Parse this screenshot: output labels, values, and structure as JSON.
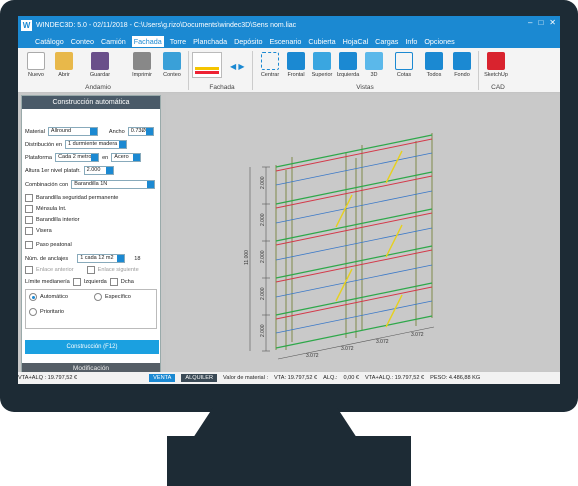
{
  "window": {
    "title": "WINDEC3D: 5.0 - 02/11/2018 - C:\\Users\\g.rizo\\Documents\\windec3D\\Sens nom.liac"
  },
  "menu": [
    "Catálogo",
    "Conteo",
    "Camión",
    "Fachada",
    "Torre",
    "Planchada",
    "Depósito",
    "Escenario",
    "Cubierta",
    "HojaCal",
    "Cargas",
    "Info",
    "Opciones"
  ],
  "menu_active": "Fachada",
  "ribbon": {
    "file_buttons": [
      "Nuevo",
      "Abrir",
      "Guardar",
      "Imprimir",
      "Conteo"
    ],
    "view_buttons": [
      "Centrar",
      "Frontal",
      "Superior",
      "Izquierda",
      "3D",
      "Cotas",
      "Todos",
      "Fondo"
    ],
    "cad_button": "SketchUp",
    "groups": {
      "andamio": "Andamio",
      "fachada": "Fachada",
      "vistas": "Vistas",
      "cad": "CAD"
    }
  },
  "panel": {
    "title": "Construcción automática",
    "material_label": "Material",
    "material_value": "Allround",
    "ancho_label": "Ancho",
    "ancho_value": "0.73Ø",
    "distribucion_label": "Distribución en",
    "distribucion_value": "1 durmiente madera",
    "plataforma_label": "Plataforma",
    "plataforma_value": "Cada 2 metros",
    "en_label": "en",
    "en_value": "Acero",
    "altura_label": "Altura 1er nivel platafr.",
    "altura_value": "2.000",
    "combinacion_label": "Combinación con",
    "combinacion_value": "Barandilla 1N",
    "checks": [
      "Barandilla seguridad permanente",
      "Ménsula Int.",
      "Barandilla interior",
      "Visera"
    ],
    "paso_peatonal": "Paso peatonal",
    "anclajes_label": "Núm. de anclajes",
    "anclajes_value": "1 cada 12 m2",
    "anclajes_count": "18",
    "enlace_anterior": "Enlace anterior",
    "enlace_siguiente": "Enlace siguiente",
    "limite_label": "Límite medianería",
    "izquierda": "Izquierda",
    "dcha": "Dcha",
    "radios": [
      "Automático",
      "Específico",
      "Prioritario"
    ],
    "build_button": "Construcción (F12)",
    "footer": "Modificación"
  },
  "dimensions": {
    "vertical": [
      "2.000",
      "2.000",
      "2.000",
      "2.000",
      "2.000",
      "2.000"
    ],
    "total_height": "11.000",
    "bottom": [
      "3.072",
      "3.072",
      "3.072",
      "3.072"
    ]
  },
  "status": {
    "left": "VTA+ALQ : 19.797,52 €",
    "tab_venta": "VENTA",
    "tab_alquiler": "ALQUILER",
    "valor": "Valor de material :",
    "vta": "VTA: 19.797,52 €",
    "alq": "ALQ.:",
    "alq_value": "0,00 €",
    "total": "VTA+ALQ.: 19.797,52 €",
    "peso": "PESO: 4.486,88 KG"
  },
  "colors": {
    "accent": "#1b89d2",
    "frame": "#1d2b35"
  }
}
